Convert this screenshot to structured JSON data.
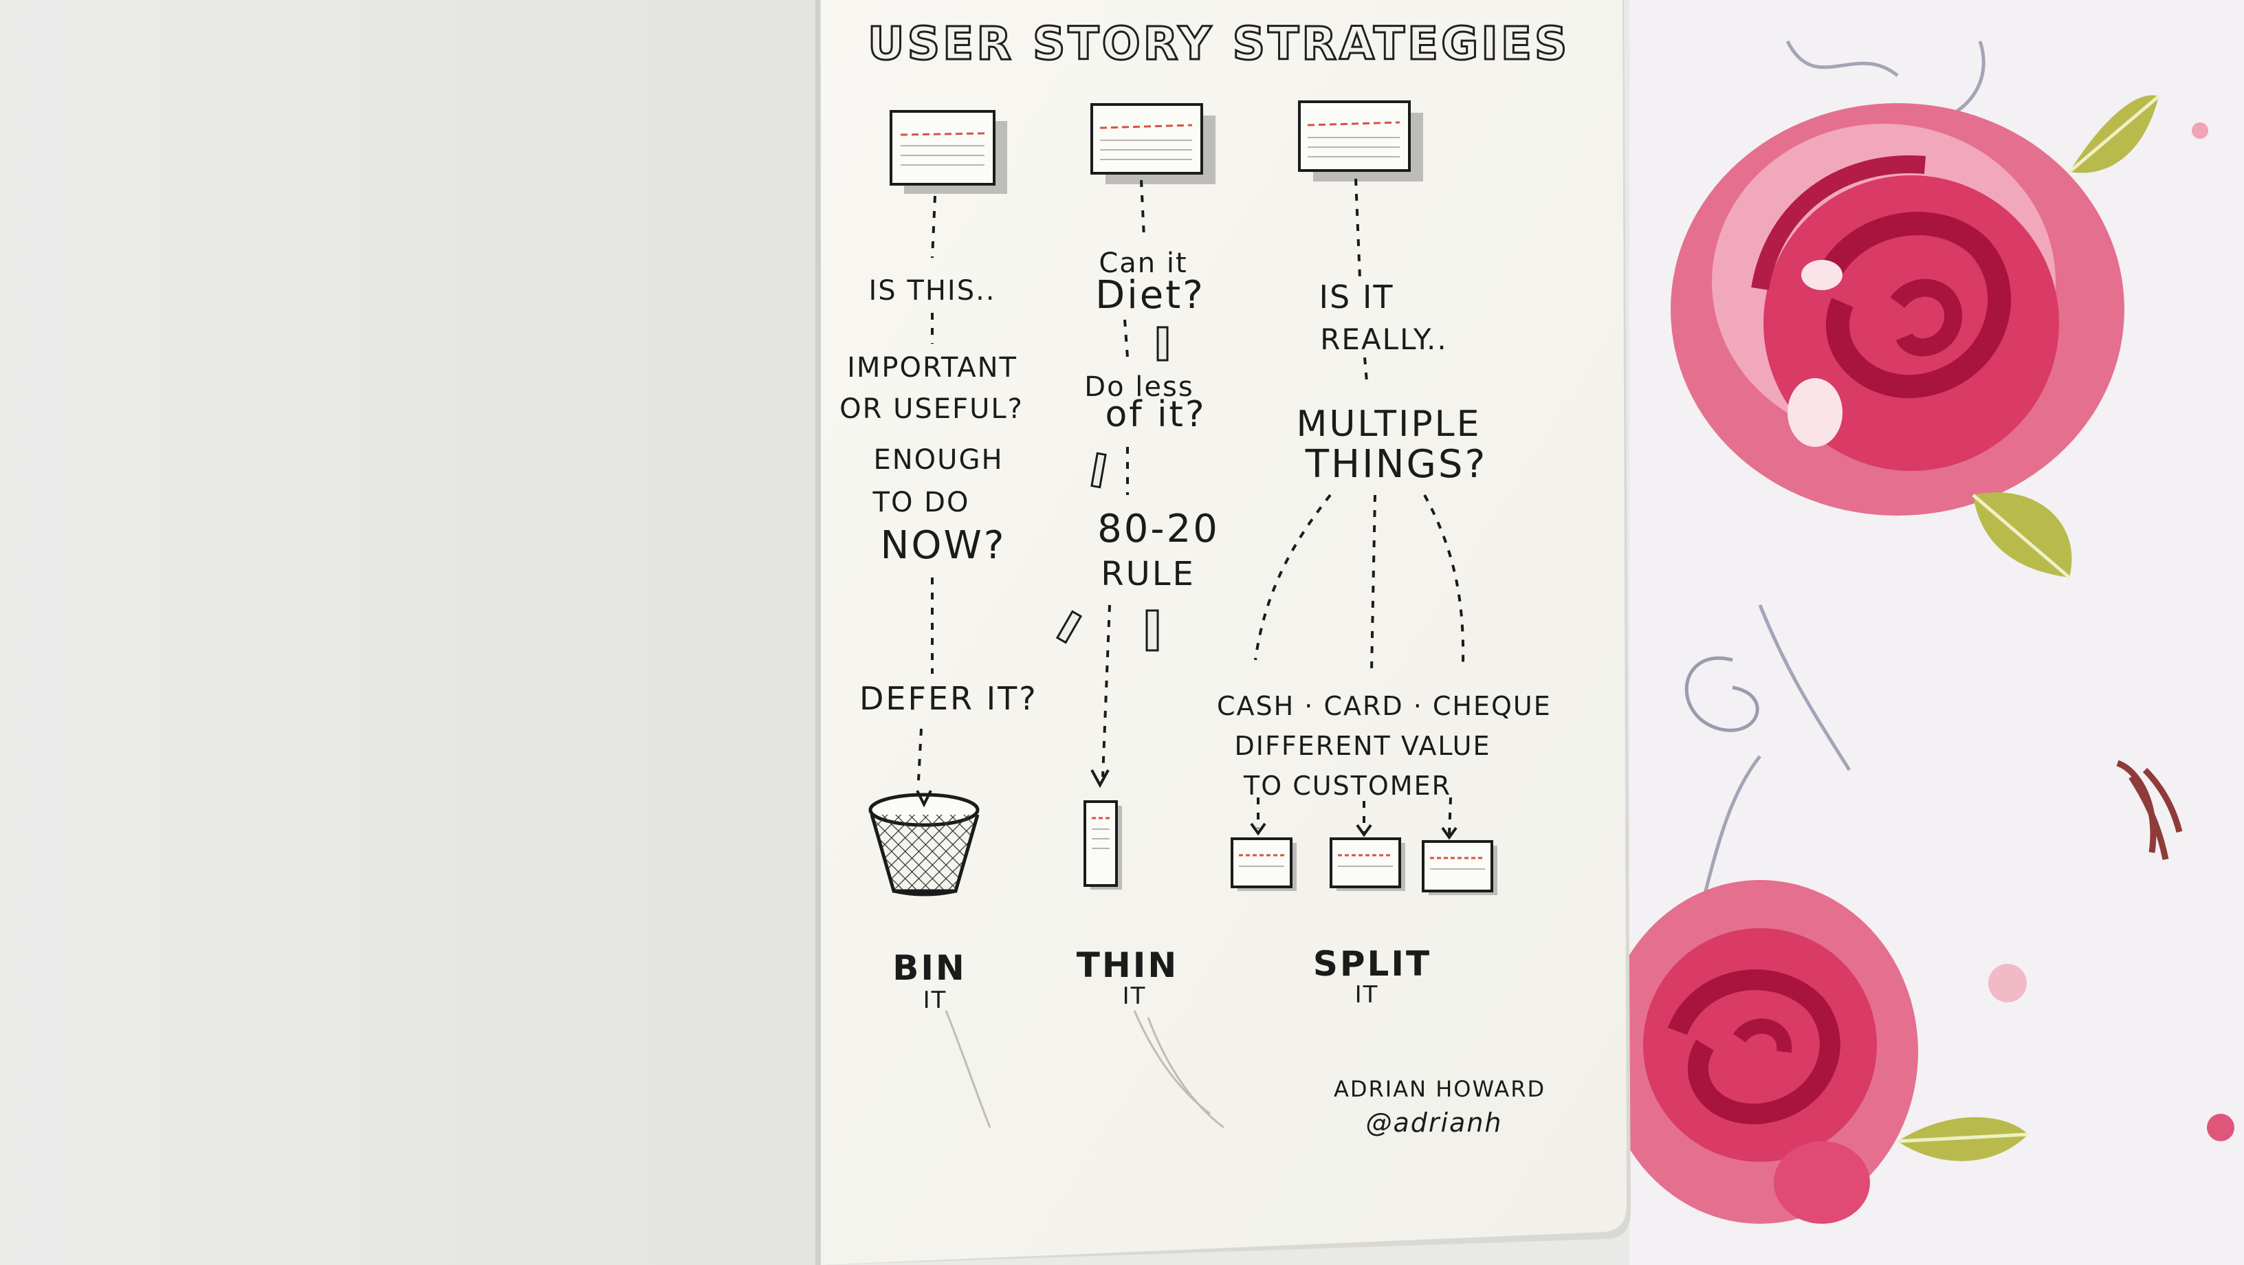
{
  "title": "USER STORY STRATEGIES",
  "columns": [
    {
      "question_lines": [
        "IS THIS..",
        "IMPORTANT",
        "OR USEFUL?",
        "ENOUGH",
        "TO DO",
        "NOW?"
      ],
      "follow_up": "DEFER IT?",
      "action": "BIN",
      "action_suffix": "IT",
      "icon": "waste-basket-icon"
    },
    {
      "question_lines": [
        "Can it",
        "Diet?",
        "Do less",
        "of it?",
        "80-20",
        "RULE"
      ],
      "action": "THIN",
      "action_suffix": "IT",
      "icon": "thin-card-icon"
    },
    {
      "question_lines": [
        "IS IT",
        "REALLY..",
        "MULTIPLE",
        "THINGS?"
      ],
      "split_note_lines": [
        "CASH · CARD · CHEQUE",
        "DIFFERENT VALUE",
        "TO CUSTOMER"
      ],
      "action": "SPLIT",
      "action_suffix": "IT",
      "icon": "split-cards-icon"
    }
  ],
  "author": {
    "name": "ADRIAN HOWARD",
    "handle": "@adrianh"
  },
  "colors": {
    "page": "#f7f6f1",
    "ink": "#1b1b1b",
    "card_line": "#d8523f",
    "fabric_rose": "#d93a66",
    "fabric_leaf": "#b7b84a"
  }
}
